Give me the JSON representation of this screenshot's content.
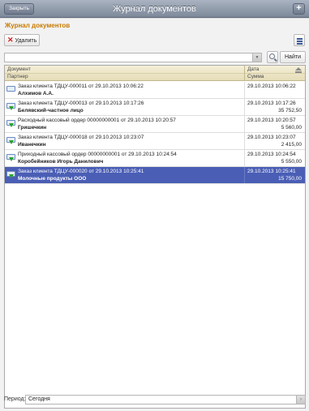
{
  "navbar": {
    "close_label": "Закрыть",
    "title": "Журнал документов",
    "add_label": "+"
  },
  "form": {
    "title": "Журнал документов",
    "delete_label": "Удалить",
    "search_placeholder": "",
    "find_label": "Найти"
  },
  "table": {
    "headers": {
      "document": "Документ",
      "partner": "Партнер",
      "date": "Дата",
      "sum": "Сумма"
    },
    "rows": [
      {
        "doc": "Заказ клиента ТДЦУ-000011 от 29.10.2013 10:06:22",
        "partner": "Алхимов А.А.",
        "date": "29.10.2013 10:06:22",
        "sum": "",
        "icon": "document-icon",
        "selected": false
      },
      {
        "doc": "Заказ клиента ТДЦУ-000013 от 29.10.2013 10:17:26",
        "partner": "Белявский-частное лицо",
        "date": "29.10.2013 10:17:26",
        "sum": "35 752,50",
        "icon": "document-posted-icon",
        "selected": false
      },
      {
        "doc": "Расходный кассовый ордер 00000000001 от 29.10.2013 10:20:57",
        "partner": "Гришечкин",
        "date": "29.10.2013 10:20:57",
        "sum": "5 560,00",
        "icon": "document-posted-icon",
        "selected": false
      },
      {
        "doc": "Заказ клиента ТДЦУ-000018 от 29.10.2013 10:23:07",
        "partner": "Иванечкин",
        "date": "29.10.2013 10:23:07",
        "sum": "2 415,00",
        "icon": "document-posted-icon",
        "selected": false
      },
      {
        "doc": "Приходный кассовый ордер 00000000001 от 29.10.2013 10:24:54",
        "partner": "Коробейников Игорь Данилович",
        "date": "29.10.2013 10:24:54",
        "sum": "5 550,00",
        "icon": "document-posted-icon",
        "selected": false
      },
      {
        "doc": "Заказ клиента ТДЦУ-000020 от 29.10.2013 10:25:41",
        "partner": "Молочные продукты ООО",
        "date": "29.10.2013 10:25:41",
        "sum": "15 750,00",
        "icon": "document-posted-icon",
        "selected": true
      }
    ]
  },
  "period": {
    "label": "Период:",
    "value": "Сегодня"
  },
  "colors": {
    "accent_title": "#c97a00",
    "selected_row": "#4a5eb5",
    "header_bg": "#e6ddb8"
  }
}
